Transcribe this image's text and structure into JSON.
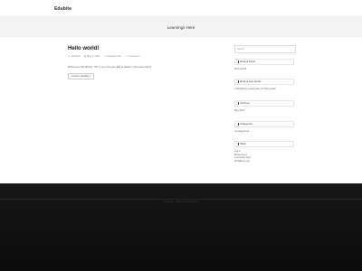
{
  "site": {
    "title": "Edubite"
  },
  "banner": {
    "title": "Learnings Here"
  },
  "post": {
    "title": "Hello world!",
    "author": "debit123",
    "date": "May 3, 2021",
    "category": "Uncategorized",
    "comments": "1 Comment",
    "excerpt": "Welcome to WordPress. This is your first post. Edit or delete it, then start writing!",
    "continue_label": "Continue Reading »"
  },
  "sidebar": {
    "search": {
      "placeholder": "Search"
    },
    "recent_posts": {
      "title": "Recent Posts",
      "items": [
        "Hello world!"
      ]
    },
    "recent_comments": {
      "title": "Recent Comments",
      "items": [
        "A WordPress Commenter on Hello world!"
      ]
    },
    "archives": {
      "title": "Archives",
      "items": [
        "May 2021"
      ]
    },
    "categories": {
      "title": "Categories",
      "items": [
        "Uncategorized"
      ]
    },
    "meta": {
      "title": "Meta",
      "items": [
        "Log in",
        "Entries feed",
        "Comments feed",
        "WordPress.org"
      ]
    }
  },
  "footer": {
    "text": "© Edubite · Powered by WordPress"
  },
  "icons": {
    "author": "user-icon",
    "date": "calendar-icon",
    "category": "folder-icon",
    "comments": "comment-icon"
  }
}
